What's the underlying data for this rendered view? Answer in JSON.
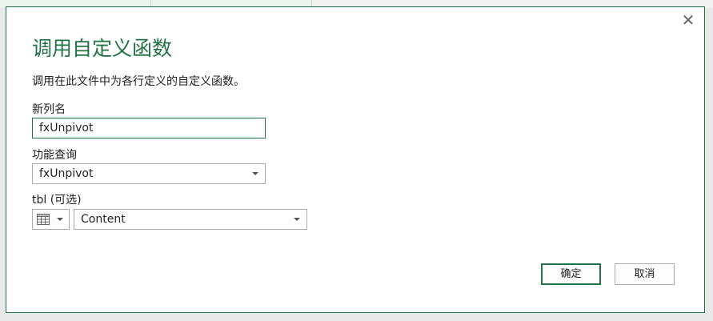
{
  "dialog": {
    "title": "调用自定义函数",
    "description": "调用在此文件中为各行定义的自定义函数。",
    "close_icon": "close-icon",
    "new_column": {
      "label": "新列名",
      "value": "fxUnpivot"
    },
    "function_query": {
      "label": "功能查询",
      "value": "fxUnpivot"
    },
    "tbl_param": {
      "label": "tbl (可选)",
      "type_icon": "table-icon",
      "value": "Content"
    },
    "buttons": {
      "ok": "确定",
      "cancel": "取消"
    }
  },
  "colors": {
    "accent": "#217346",
    "border": "#ababab"
  }
}
